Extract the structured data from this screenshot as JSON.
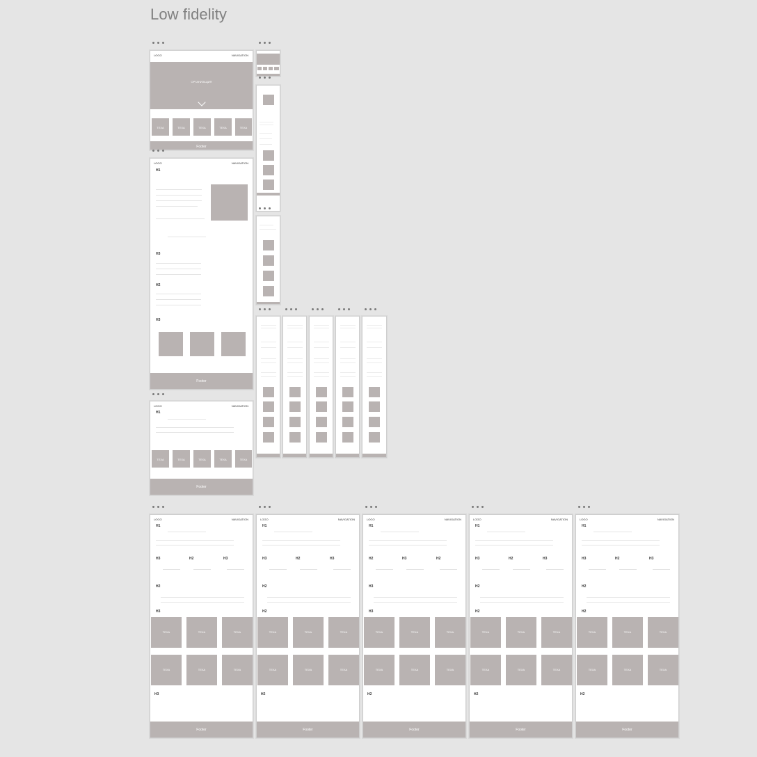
{
  "page": {
    "title": "Low fidelity"
  },
  "wire": {
    "logo": "LOGO",
    "navigation": "NAVIGATION",
    "h1": "H1",
    "h2": "H2",
    "h3": "H3",
    "footer": "Footer",
    "hero_text": "ОРГАНИЗАЦИЯ",
    "tile_label": "TEXA"
  },
  "icons": {
    "frame_menu": "more-dots-icon",
    "scroll_down": "chevron-down-icon"
  },
  "colors": {
    "background": "#e5e5e5",
    "placeholder": "#b9b3b2",
    "frame": "#ffffff",
    "title": "#808080"
  }
}
